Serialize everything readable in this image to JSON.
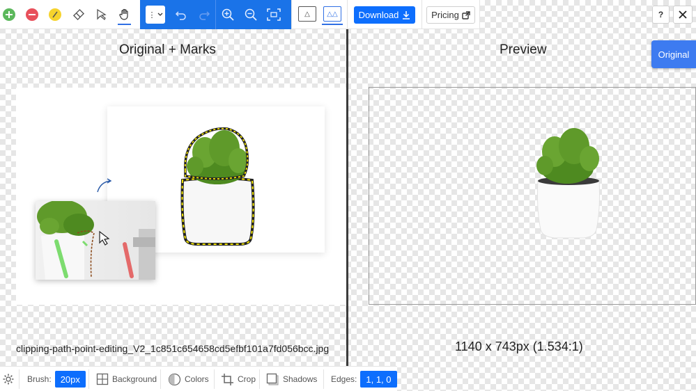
{
  "toolbar": {
    "tools": [
      {
        "name": "add-mark-icon",
        "color": "#5cb85c"
      },
      {
        "name": "remove-mark-icon",
        "color": "#e8505b"
      },
      {
        "name": "pencil-icon",
        "color": "#f6d32d"
      },
      {
        "name": "eraser-icon"
      },
      {
        "name": "select-arrow-icon"
      },
      {
        "name": "pan-hand-icon",
        "active": true
      }
    ],
    "blue_group_color": "#1a73e8",
    "dropdown_label": "⋮",
    "download_label": "Download",
    "pricing_label": "Pricing",
    "help_label": "?",
    "view_single_label": "△",
    "view_split_label": "△△"
  },
  "left_panel": {
    "title": "Original + Marks",
    "filename": "clipping-path-point-editing_V2_1c851c654658cd5efbf101a7fd056bcc.jpg"
  },
  "right_panel": {
    "title": "Preview",
    "original_badge": "Original",
    "dimensions": "1140 x 743px (1.534:1)"
  },
  "bottom_bar": {
    "brush_label": "Brush:",
    "brush_value": "20px",
    "background_label": "Background",
    "colors_label": "Colors",
    "crop_label": "Crop",
    "shadows_label": "Shadows",
    "edges_label": "Edges:",
    "edges_value": "1, 1, 0"
  },
  "colors": {
    "accent": "#0d6efd",
    "plant_green": "#5f9a2a",
    "mark_yellow": "#f2e400",
    "mark_green": "#7ddc6f",
    "mark_red": "#e46a6a"
  }
}
